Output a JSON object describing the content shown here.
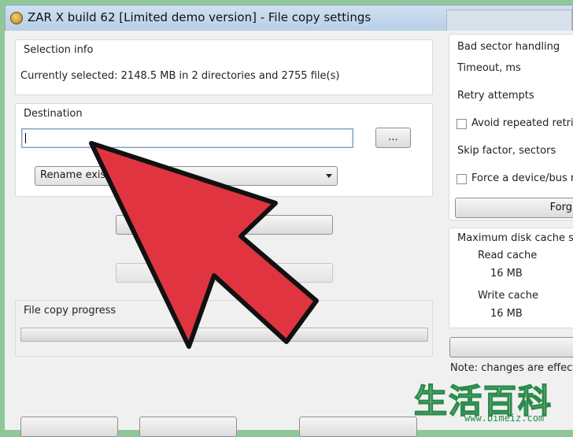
{
  "window": {
    "title": "ZAR X build 62 [Limited demo version] - File copy settings"
  },
  "selection": {
    "label": "Selection info",
    "text": "Currently selected: 2148.5 MB in 2 directories and 2755 file(s)"
  },
  "destination": {
    "label": "Destination",
    "path_value": "",
    "browse_label": "...",
    "mode_selected": "Rename existi"
  },
  "progress": {
    "label": "File copy progress",
    "value": 0
  },
  "bad_sector": {
    "label": "Bad sector handling",
    "timeout_label": "Timeout, ms",
    "retry_label": "Retry attempts",
    "avoid_label": "Avoid repeated retrie",
    "skip_label": "Skip factor, sectors",
    "force_label": "Force a device/bus r",
    "forget_label": "Forg"
  },
  "cache": {
    "label": "Maximum disk cache siz",
    "read_label": "Read cache",
    "read_value": "16 MB",
    "write_label": "Write cache",
    "write_value": "16 MB"
  },
  "note": "Note: changes are effecti",
  "watermark": {
    "chars": "生活百科",
    "url": "www.bimeiz.com"
  },
  "colors": {
    "arrow_fill": "#e03540",
    "arrow_stroke": "#111111",
    "watermark": "#2a8a4a"
  }
}
